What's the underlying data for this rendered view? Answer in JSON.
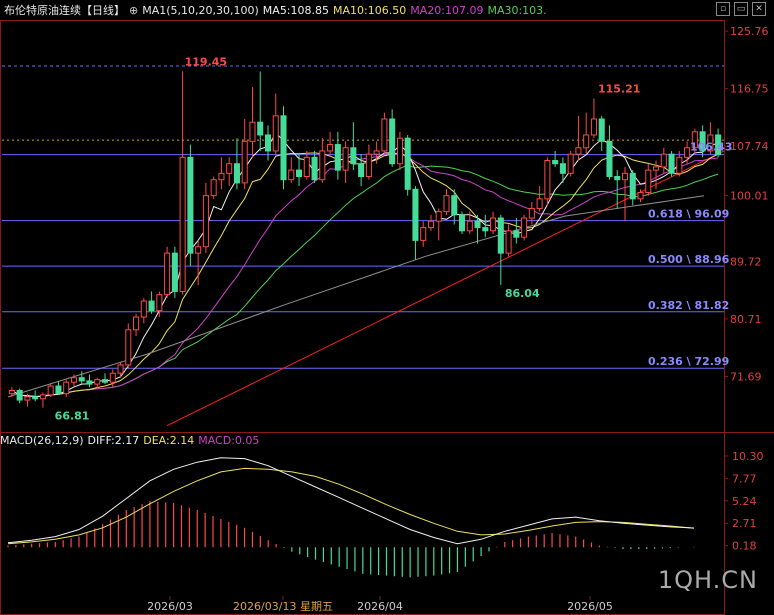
{
  "header": {
    "title": "布伦特原油连续",
    "period": "【日线】",
    "ma_label": "MA1(5,10,20,30,100)",
    "ma5": "MA5:108.85",
    "ma10": "MA10:106.50",
    "ma20": "MA20:107.09",
    "ma30": "MA30:103."
  },
  "macd_header": {
    "label": "MACD(26,12,9)",
    "diff": "DIFF:2.17",
    "dea": "DEA:2.14",
    "macd": "MACD:0.05"
  },
  "watermark": "1QH.CN",
  "colors": {
    "up": "#ff4848",
    "down": "#45dc9a",
    "ma5": "#f2f2f2",
    "ma10": "#f0e060",
    "ma20": "#d040d0",
    "ma30": "#50d050",
    "ma100": "#909090",
    "fib": "#6a6aff",
    "trend": "#ff2020"
  },
  "chart_data": [
    {
      "type": "candlestick",
      "title": "布伦特原油连续 日线",
      "y_ticks": [
        "125.76",
        "116.75",
        "107.74",
        "100.01",
        "89.72",
        "80.71",
        "71.69"
      ],
      "x_ticks": [
        "2026/03",
        "2026/03/13 星期五",
        "2026/04",
        "2026/05"
      ],
      "annotations": {
        "high": "119.45",
        "low": "86.04",
        "start_low": "66.81",
        "recent_high": "115.21",
        "last_price": "106.43"
      },
      "fib_levels": [
        {
          "label": "0.618 \\ 96.09",
          "value": 96.09
        },
        {
          "label": "0.500 \\ 88.96",
          "value": 88.96
        },
        {
          "label": "0.382 \\ 81.82",
          "value": 81.82
        },
        {
          "label": "0.236 \\ 72.99",
          "value": 72.99
        }
      ],
      "ohlc": [
        [
          69.0,
          70.0,
          68.5,
          69.5
        ],
        [
          69.5,
          69.8,
          67.5,
          68.0
        ],
        [
          68.0,
          69.0,
          67.0,
          68.5
        ],
        [
          68.5,
          69.5,
          67.8,
          68.2
        ],
        [
          68.2,
          69.2,
          66.8,
          68.8
        ],
        [
          68.8,
          70.5,
          68.5,
          70.2
        ],
        [
          70.2,
          71.0,
          68.8,
          69.0
        ],
        [
          69.0,
          71.2,
          68.5,
          70.8
        ],
        [
          70.8,
          72.0,
          70.2,
          71.5
        ],
        [
          71.5,
          72.5,
          70.5,
          71.0
        ],
        [
          71.0,
          72.0,
          70.0,
          70.5
        ],
        [
          70.5,
          71.5,
          69.8,
          71.2
        ],
        [
          71.2,
          72.2,
          70.5,
          70.8
        ],
        [
          70.8,
          72.8,
          70.0,
          72.2
        ],
        [
          72.2,
          74.0,
          71.5,
          73.5
        ],
        [
          73.5,
          80.0,
          73.0,
          79.0
        ],
        [
          79.0,
          81.5,
          78.0,
          81.0
        ],
        [
          81.0,
          84.0,
          80.0,
          83.5
        ],
        [
          83.5,
          85.0,
          81.5,
          82.0
        ],
        [
          82.0,
          85.0,
          81.0,
          84.5
        ],
        [
          84.5,
          92.0,
          84.0,
          91.0
        ],
        [
          91.0,
          92.0,
          84.0,
          85.0
        ],
        [
          85.0,
          119.45,
          84.5,
          106.0
        ],
        [
          106.0,
          108.0,
          89.0,
          91.0
        ],
        [
          91.0,
          93.0,
          86.0,
          92.0
        ],
        [
          92.0,
          102.0,
          91.0,
          100.0
        ],
        [
          100.0,
          103.0,
          99.5,
          102.5
        ],
        [
          102.5,
          106.0,
          101.0,
          103.5
        ],
        [
          103.5,
          106.0,
          101.5,
          105.0
        ],
        [
          105.0,
          109.0,
          101.0,
          102.0
        ],
        [
          102.0,
          112.0,
          101.0,
          108.5
        ],
        [
          108.5,
          117.0,
          106.0,
          111.5
        ],
        [
          111.5,
          119.45,
          107.0,
          109.5
        ],
        [
          109.5,
          111.0,
          105.5,
          107.0
        ],
        [
          107.0,
          116.0,
          106.5,
          112.5
        ],
        [
          112.5,
          114.0,
          101.0,
          102.5
        ],
        [
          102.5,
          106.0,
          102.0,
          104.0
        ],
        [
          104.0,
          106.5,
          101.5,
          103.0
        ],
        [
          103.0,
          107.0,
          102.5,
          106.0
        ],
        [
          106.0,
          107.0,
          102.0,
          102.5
        ],
        [
          102.5,
          109.0,
          102.0,
          107.0
        ],
        [
          107.0,
          110.0,
          106.5,
          108.0
        ],
        [
          108.0,
          110.0,
          102.5,
          104.0
        ],
        [
          104.0,
          108.5,
          102.0,
          107.5
        ],
        [
          107.5,
          111.5,
          104.0,
          105.0
        ],
        [
          105.0,
          106.5,
          101.5,
          103.0
        ],
        [
          103.0,
          108.0,
          102.5,
          106.5
        ],
        [
          106.5,
          108.5,
          105.0,
          107.0
        ],
        [
          107.0,
          113.0,
          106.5,
          112.0
        ],
        [
          112.0,
          113.5,
          104.5,
          105.0
        ],
        [
          105.0,
          110.0,
          104.0,
          109.0
        ],
        [
          109.0,
          109.5,
          100.0,
          101.0
        ],
        [
          101.0,
          101.5,
          90.0,
          93.0
        ],
        [
          93.0,
          96.0,
          92.0,
          95.0
        ],
        [
          95.0,
          97.0,
          94.5,
          96.0
        ],
        [
          96.0,
          98.0,
          93.0,
          97.5
        ],
        [
          97.5,
          101.0,
          97.0,
          100.0
        ],
        [
          100.0,
          101.0,
          95.5,
          97.0
        ],
        [
          97.0,
          97.5,
          94.0,
          94.5
        ],
        [
          94.5,
          97.5,
          94.0,
          96.0
        ],
        [
          96.0,
          97.0,
          92.5,
          95.0
        ],
        [
          95.0,
          97.0,
          93.5,
          94.5
        ],
        [
          94.5,
          97.5,
          94.0,
          96.5
        ],
        [
          96.5,
          97.0,
          86.04,
          91.0
        ],
        [
          91.0,
          95.5,
          90.5,
          94.5
        ],
        [
          94.5,
          96.5,
          92.5,
          93.5
        ],
        [
          93.5,
          97.0,
          93.0,
          96.5
        ],
        [
          96.5,
          99.0,
          95.5,
          98.0
        ],
        [
          98.0,
          101.5,
          97.5,
          99.5
        ],
        [
          99.5,
          106.0,
          98.5,
          105.5
        ],
        [
          105.5,
          107.0,
          104.5,
          105.0
        ],
        [
          105.0,
          106.0,
          102.0,
          103.5
        ],
        [
          103.5,
          107.0,
          103.0,
          106.5
        ],
        [
          106.5,
          112.5,
          105.5,
          107.5
        ],
        [
          107.5,
          113.0,
          106.5,
          109.5
        ],
        [
          109.5,
          115.21,
          109.0,
          112.0
        ],
        [
          112.0,
          112.5,
          107.0,
          108.5
        ],
        [
          108.5,
          111.0,
          102.5,
          103.0
        ],
        [
          103.0,
          104.0,
          98.0,
          102.5
        ],
        [
          102.5,
          104.5,
          96.0,
          103.5
        ],
        [
          103.5,
          104.0,
          98.5,
          99.5
        ],
        [
          99.5,
          101.0,
          99.0,
          100.5
        ],
        [
          100.5,
          105.0,
          100.0,
          104.0
        ],
        [
          104.0,
          105.5,
          101.0,
          104.5
        ],
        [
          104.5,
          107.5,
          103.5,
          106.5
        ],
        [
          106.5,
          107.0,
          103.0,
          103.5
        ],
        [
          103.5,
          107.0,
          103.0,
          106.0
        ],
        [
          106.0,
          108.5,
          105.0,
          107.5
        ],
        [
          107.5,
          110.5,
          106.5,
          110.0
        ],
        [
          110.0,
          111.0,
          106.0,
          107.0
        ],
        [
          107.0,
          111.5,
          106.5,
          109.5
        ],
        [
          109.5,
          110.5,
          106.0,
          106.43
        ]
      ],
      "ma100": [
        68.5,
        75.2,
        83.0,
        90.5,
        96.8,
        100.0
      ]
    },
    {
      "type": "macd",
      "y_ticks": [
        "10.30",
        "7.77",
        "5.24",
        "2.71",
        "0.18"
      ],
      "diff": [
        0.5,
        0.8,
        1.2,
        2.0,
        3.5,
        5.5,
        7.5,
        8.8,
        9.6,
        10.1,
        10.0,
        9.2,
        8.0,
        6.8,
        5.6,
        4.4,
        3.2,
        2.0,
        1.1,
        0.4,
        0.9,
        1.8,
        2.5,
        3.2,
        3.4,
        3.0,
        2.7,
        2.5,
        2.3,
        2.17
      ],
      "dea": [
        0.4,
        0.6,
        0.9,
        1.4,
        2.2,
        3.4,
        4.9,
        6.3,
        7.5,
        8.5,
        8.9,
        8.8,
        8.5,
        8.0,
        7.1,
        6.0,
        4.8,
        3.7,
        2.7,
        1.8,
        1.4,
        1.5,
        1.9,
        2.4,
        2.8,
        2.9,
        2.8,
        2.6,
        2.4,
        2.14
      ],
      "histogram": [
        0.2,
        0.4,
        0.6,
        1.2,
        2.6,
        4.2,
        5.2,
        5.0,
        4.2,
        3.2,
        2.2,
        0.8,
        -0.5,
        -1.4,
        -2.2,
        -3.0,
        -3.2,
        -3.4,
        -3.2,
        -2.8,
        -1.0,
        0.6,
        1.2,
        1.6,
        1.2,
        0.2,
        -0.2,
        -0.2,
        -0.1,
        0.05
      ]
    }
  ]
}
